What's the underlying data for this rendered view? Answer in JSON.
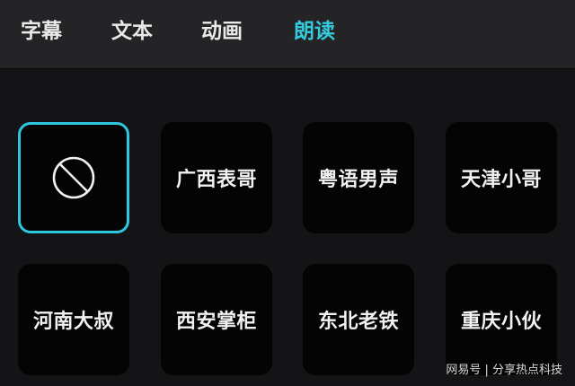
{
  "tabs": [
    {
      "label": "字幕",
      "active": false
    },
    {
      "label": "文本",
      "active": false
    },
    {
      "label": "动画",
      "active": false
    },
    {
      "label": "朗读",
      "active": true
    }
  ],
  "voices": [
    {
      "label": "",
      "icon": "none-icon",
      "selected": true
    },
    {
      "label": "广西表哥",
      "selected": false
    },
    {
      "label": "粤语男声",
      "selected": false
    },
    {
      "label": "天津小哥",
      "selected": false
    },
    {
      "label": "河南大叔",
      "selected": false
    },
    {
      "label": "西安掌柜",
      "selected": false
    },
    {
      "label": "东北老铁",
      "selected": false
    },
    {
      "label": "重庆小伙",
      "selected": false
    }
  ],
  "watermark": "网易号 | 分享热点科技",
  "colors": {
    "accent": "#35c9dc",
    "selected_border": "#2ec7df",
    "tile_bg": "#040405",
    "tabbar_bg": "#242427",
    "page_bg": "#141416"
  }
}
